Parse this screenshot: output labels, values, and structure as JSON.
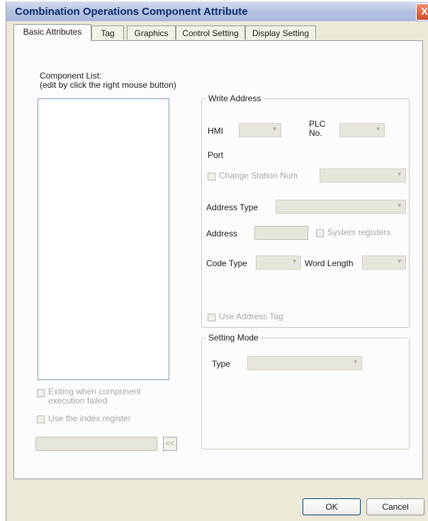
{
  "window": {
    "title": "Combination Operations Component Attribute",
    "close_glyph": "X"
  },
  "tabs": [
    {
      "label": "Basic Attributes",
      "active": true
    },
    {
      "label": "Tag",
      "active": false
    },
    {
      "label": "Graphics",
      "active": false
    },
    {
      "label": "Control Setting",
      "active": false
    },
    {
      "label": "Display Setting",
      "active": false
    }
  ],
  "component_list": {
    "label_line1": "Component List:",
    "label_line2": "(edit by click the right mouse button)",
    "items": []
  },
  "options": {
    "exit_on_fail_line1": "Exiting when component",
    "exit_on_fail_line2": "execution failed",
    "use_index_register": "Use the index register",
    "index_input_value": "",
    "insert_button": "<<"
  },
  "write_address": {
    "legend": "Write Address",
    "hmi_label": "HMI",
    "hmi_value": "",
    "plc_label_line1": "PLC",
    "plc_label_line2": "No.",
    "plc_value": "",
    "port_label": "Port",
    "change_station": "Change Station Num",
    "change_station_value": "",
    "address_type_label": "Address Type",
    "address_type_value": "",
    "address_label": "Address",
    "address_value": "",
    "system_registers": "System registers",
    "code_type_label": "Code Type",
    "code_type_value": "",
    "word_length_label": "Word Length",
    "word_length_value": "",
    "use_address_tag": "Use Address Tag"
  },
  "setting_mode": {
    "legend": "Setting Mode",
    "type_label": "Type",
    "type_value": ""
  },
  "footer": {
    "ok": "OK",
    "cancel": "Cancel"
  },
  "icons": {
    "dropdown": "chevron-down-icon",
    "close": "close-icon"
  },
  "colors": {
    "dialog_bg": "#ece9d8",
    "title_text": "#0b2a6f",
    "close_red": "#d24a28",
    "disabled_text": "#a7a6aa"
  }
}
